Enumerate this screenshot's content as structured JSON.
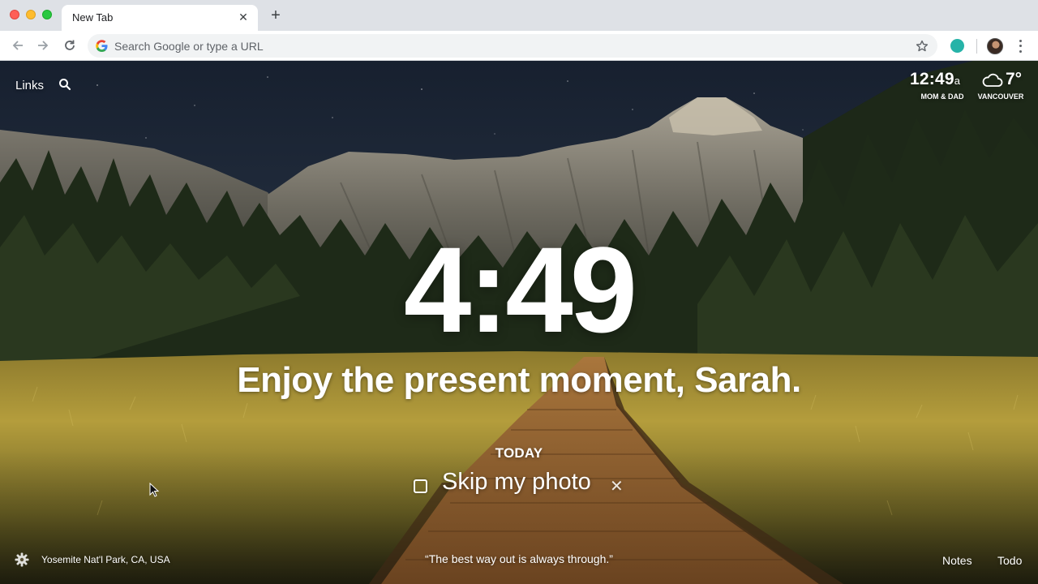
{
  "browser": {
    "tab": {
      "title": "New Tab",
      "close_icon": "close-icon"
    },
    "new_tab_icon": "plus-icon",
    "toolbar": {
      "back_icon": "arrow-left-icon",
      "forward_icon": "arrow-right-icon",
      "reload_icon": "reload-icon",
      "omnibox": {
        "placeholder": "Search Google or type a URL",
        "value": ""
      },
      "bookmark_icon": "star-icon",
      "extension_color": "#26b3a8",
      "menu_icon": "kebab-menu-icon"
    }
  },
  "dashboard": {
    "top_left": {
      "links_label": "Links",
      "search_icon": "search-icon"
    },
    "world_clock": {
      "time": "12:49",
      "ampm": "a",
      "label": "MOM & DAD"
    },
    "weather": {
      "icon": "cloud-icon",
      "temperature": "7°",
      "location": "VANCOUVER"
    },
    "clock": "4:49",
    "greeting": "Enjoy the present moment, Sarah.",
    "focus": {
      "heading": "TODAY",
      "task": "Skip my photo",
      "done": false
    },
    "bottom": {
      "settings_icon": "gear-icon",
      "photo_location": "Yosemite Nat'l Park, CA, USA",
      "quote": "“The best way out is always through.”",
      "notes_label": "Notes",
      "todo_label": "Todo"
    }
  }
}
